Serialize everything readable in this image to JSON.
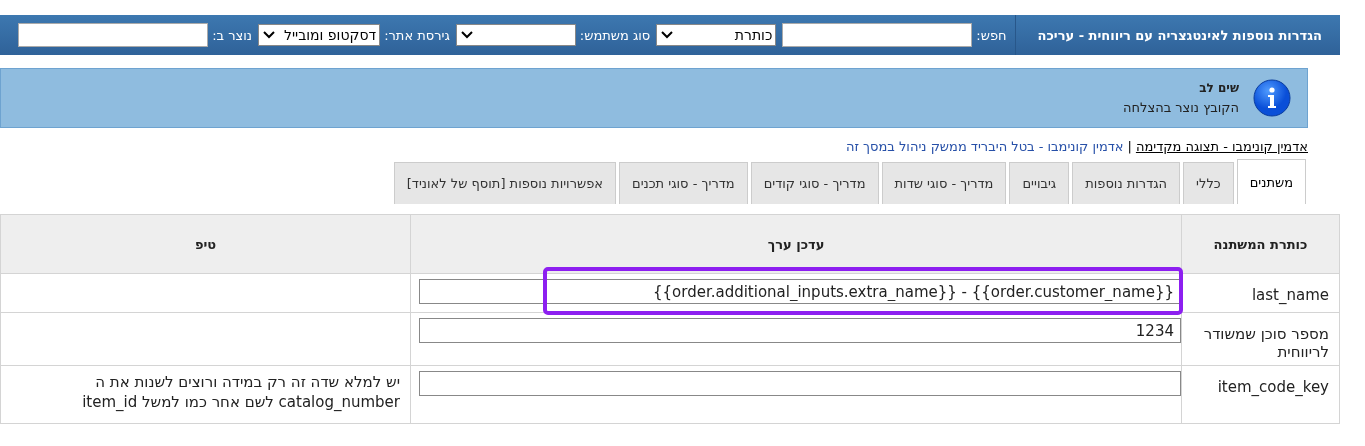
{
  "header": {
    "title": "הגדרות נוספות לאינטגצריה עם ריווחית - עריכה",
    "filters": [
      {
        "kind": "input",
        "label": "חפש:"
      },
      {
        "kind": "select",
        "value": "כותרת"
      },
      {
        "kind": "select",
        "label": "סוג משתמש:"
      },
      {
        "kind": "select",
        "label": "גירסת אתר:",
        "value": "דסקטופ ומובייל"
      },
      {
        "kind": "input",
        "label": "נוצר ב:"
      }
    ]
  },
  "notice": {
    "title": "שים לב",
    "message": "הקובץ נוצר בהצלחה"
  },
  "link_separator": "|",
  "links": [
    {
      "text": "אדמין קונימבו - תצוגה מקדימה",
      "kind": "dark"
    },
    {
      "text": "אדמין קונימבו - בטל היבריד ממשק ניהול במסך זה",
      "kind": "blue"
    }
  ],
  "tabs": [
    {
      "label": "משתנים",
      "selected": true
    },
    {
      "label": "כללי",
      "selected": false
    },
    {
      "label": "הגדרות נוספות",
      "selected": false
    },
    {
      "label": "גיבויים",
      "selected": false
    },
    {
      "label": "מדריך - סוגי שדות",
      "selected": false
    },
    {
      "label": "מדריך - סוגי קודים",
      "selected": false
    },
    {
      "label": "מדריך - סוגי תכנים",
      "selected": false
    },
    {
      "label": "אפשרויות נוספות [תוסף של לאוניד]",
      "selected": false
    }
  ],
  "table": {
    "columns": [
      "כותרת המשתנה",
      "עדכן ערך",
      "טיפ"
    ],
    "rows": [
      {
        "name": "last_name",
        "value": "{{order.additional_inputs.extra_name}} - {{order.customer_name}}",
        "highlighted": true
      },
      {
        "name": "מספר סוכן שמשודר לריווחית",
        "value": "1234",
        "highlighted": false
      },
      {
        "name": "item_code_key",
        "tip": "יש למלא שדה זה רק במידה ורוצים לשנות את ה catalog_number לשם אחר כמו למשל item_id",
        "highlighted": false
      }
    ]
  }
}
